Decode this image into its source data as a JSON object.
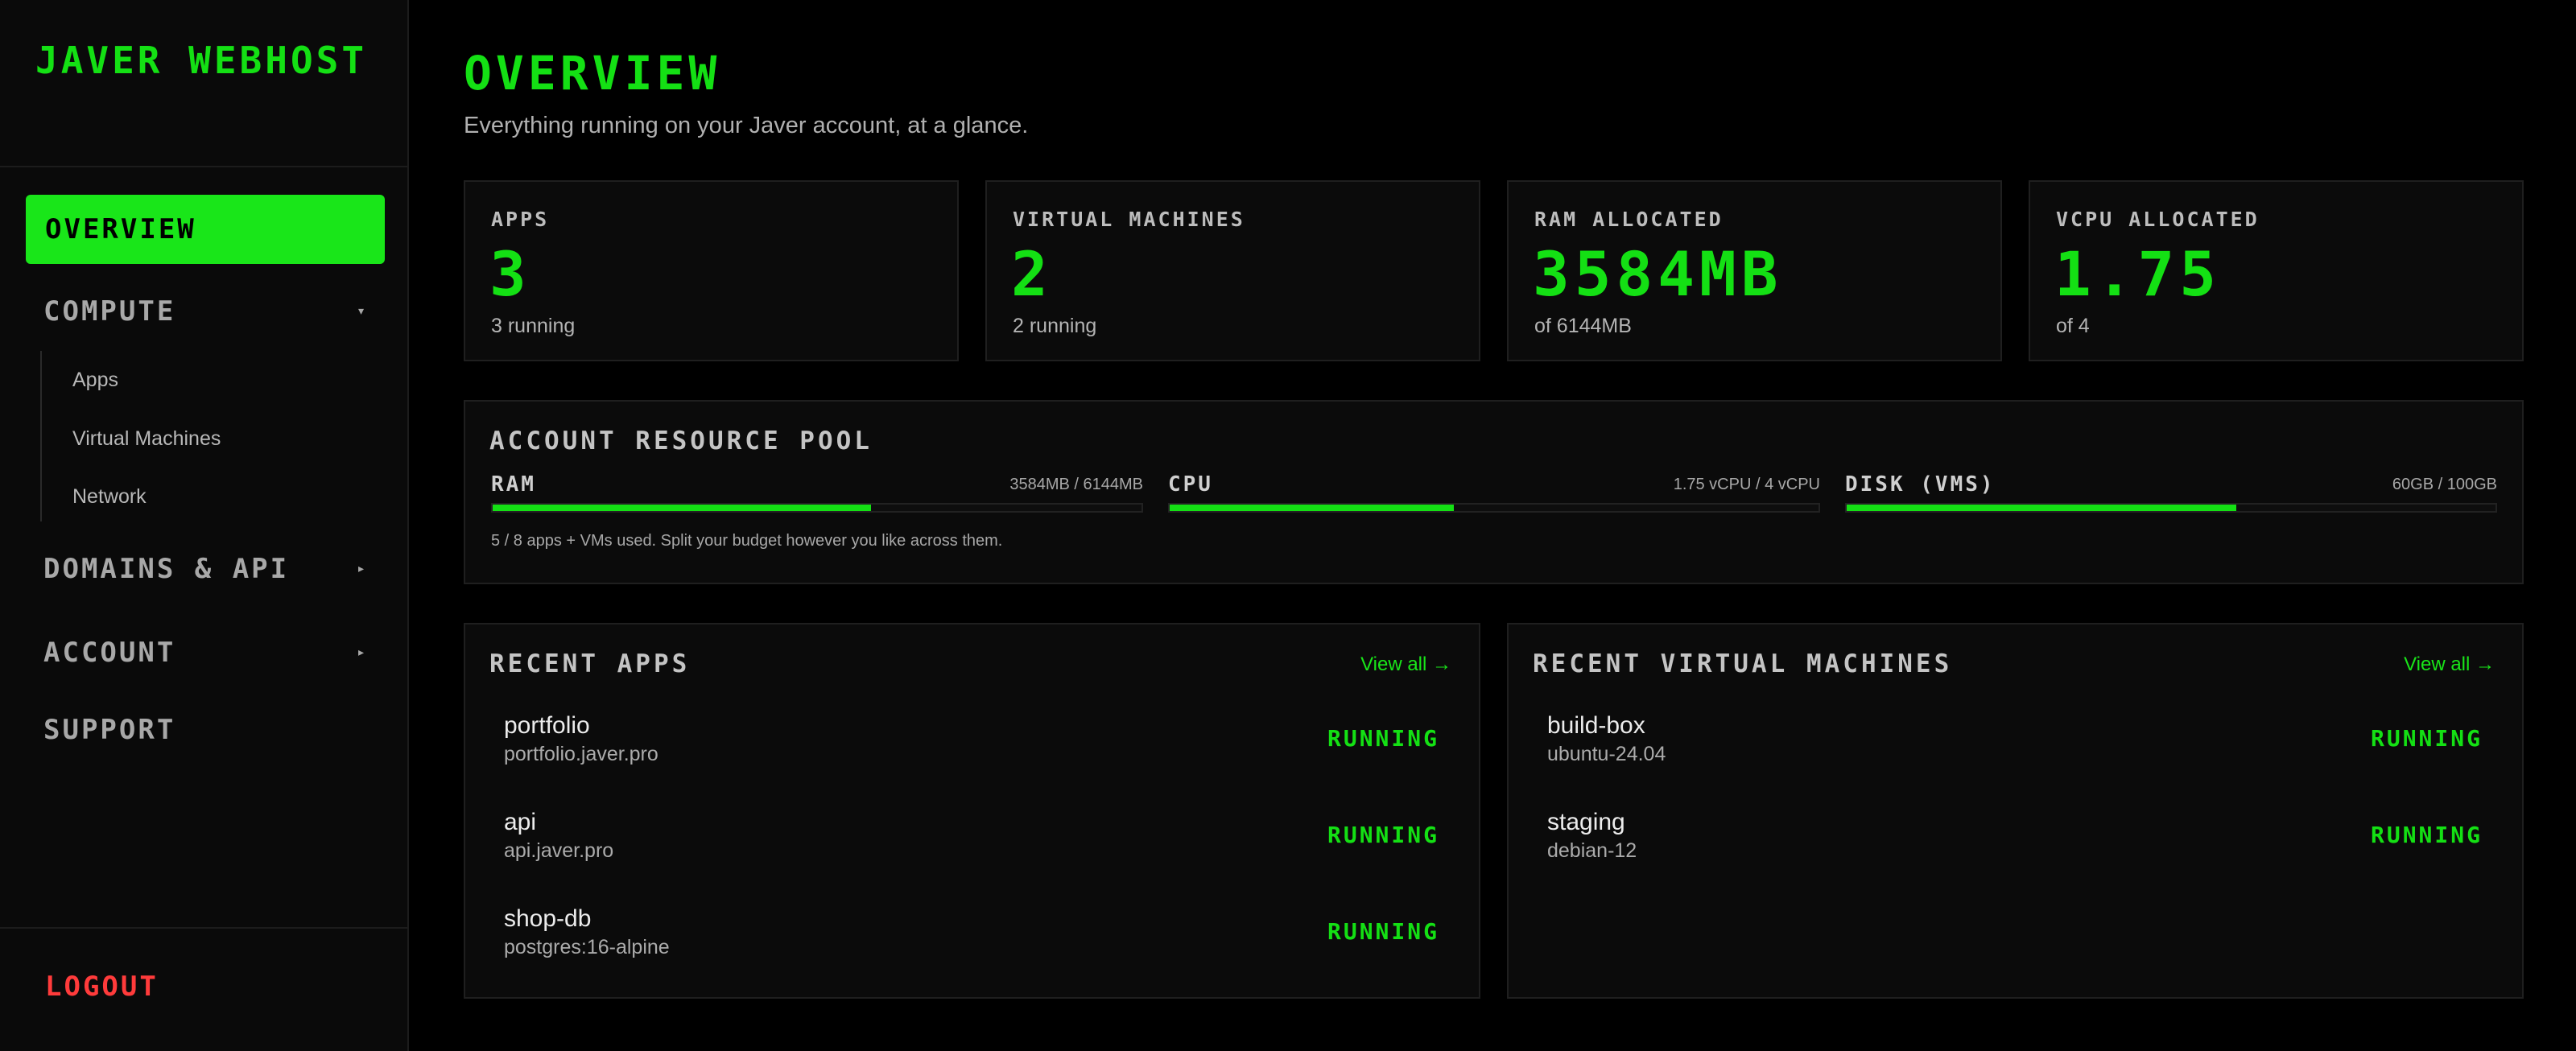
{
  "brand": {
    "name": "JAVER WEBHOST"
  },
  "nav": {
    "overview": "OVERVIEW",
    "compute": "COMPUTE",
    "compute_sub": [
      "Apps",
      "Virtual Machines",
      "Network"
    ],
    "domains": "DOMAINS & API",
    "account": "ACCOUNT",
    "support": "SUPPORT",
    "logout": "LOGOUT",
    "arrow_open": "▾",
    "arrow_closed": "▸"
  },
  "page": {
    "title": "OVERVIEW",
    "subtitle": "Everything running on your Javer account, at a glance."
  },
  "stats": [
    {
      "label": "APPS",
      "value": "3",
      "note": "3 running"
    },
    {
      "label": "VIRTUAL MACHINES",
      "value": "2",
      "note": "2 running"
    },
    {
      "label": "RAM ALLOCATED",
      "value": "3584MB",
      "note": "of 6144MB"
    },
    {
      "label": "VCPU ALLOCATED",
      "value": "1.75",
      "note": "of 4"
    }
  ],
  "pool": {
    "title": "ACCOUNT RESOURCE POOL",
    "meters": [
      {
        "label": "RAM",
        "value": "3584MB / 6144MB",
        "fraction": 0.583
      },
      {
        "label": "CPU",
        "value": "1.75 vCPU / 4 vCPU",
        "fraction": 0.4375
      },
      {
        "label": "DISK (VMS)",
        "value": "60GB / 100GB",
        "fraction": 0.6
      }
    ],
    "note": "5 / 8 apps + VMs used. Split your budget however you like across them."
  },
  "recent_apps": {
    "title": "RECENT APPS",
    "view_all": "View all →",
    "items": [
      {
        "name": "portfolio",
        "sub": "portfolio.javer.pro",
        "status": "RUNNING"
      },
      {
        "name": "api",
        "sub": "api.javer.pro",
        "status": "RUNNING"
      },
      {
        "name": "shop-db",
        "sub": "postgres:16-alpine",
        "status": "RUNNING"
      }
    ]
  },
  "recent_vms": {
    "title": "RECENT VIRTUAL MACHINES",
    "view_all": "View all →",
    "items": [
      {
        "name": "build-box",
        "sub": "ubuntu-24.04",
        "status": "RUNNING"
      },
      {
        "name": "staging",
        "sub": "debian-12",
        "status": "RUNNING"
      }
    ]
  },
  "colors": {
    "accent": "#14e014",
    "danger": "#ff3b3b",
    "background": "#000000",
    "card": "#0b0b0b"
  }
}
